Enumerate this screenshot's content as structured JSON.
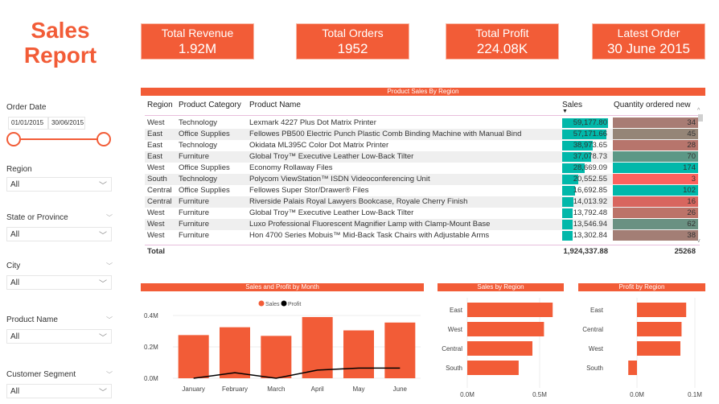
{
  "title": "Sales Report",
  "title_lines": [
    "Sales",
    "Report"
  ],
  "colors": {
    "accent": "#f25c37",
    "teal": "#01b8aa",
    "red": "#fd625e"
  },
  "kpis": [
    {
      "label": "Total Revenue",
      "value": "1.92M"
    },
    {
      "label": "Total Orders",
      "value": "1952"
    },
    {
      "label": "Total Profit",
      "value": "224.08K"
    },
    {
      "label": "Latest Order",
      "value": "30 June 2015"
    }
  ],
  "filters": {
    "order_date": {
      "label": "Order Date",
      "start": "01/01/2015",
      "end": "30/06/2015"
    },
    "region": {
      "label": "Region",
      "value": "All"
    },
    "state": {
      "label": "State or Province",
      "value": "All"
    },
    "city": {
      "label": "City",
      "value": "All"
    },
    "product_name": {
      "label": "Product Name",
      "value": "All"
    },
    "customer_segment": {
      "label": "Customer Segment",
      "value": "All"
    }
  },
  "table": {
    "title": "Product Sales By Region",
    "columns": [
      "Region",
      "Product Category",
      "Product Name",
      "Sales",
      "Quantity ordered new"
    ],
    "sort_indicator": "▼",
    "rows": [
      {
        "region": "West",
        "category": "Technology",
        "product": "Lexmark 4227 Plus Dot Matrix Printer",
        "sales": "59,177.80",
        "sales_num": 59177.8,
        "qty": "34",
        "qty_color": "#a87c74"
      },
      {
        "region": "East",
        "category": "Office Supplies",
        "product": "Fellowes PB500 Electric Punch Plastic Comb Binding Machine with Manual Bind",
        "sales": "57,171.66",
        "sales_num": 57171.66,
        "qty": "45",
        "qty_color": "#958577"
      },
      {
        "region": "East",
        "category": "Technology",
        "product": "Okidata ML395C Color Dot Matrix Printer",
        "sales": "38,973.65",
        "sales_num": 38973.65,
        "qty": "28",
        "qty_color": "#b7756c"
      },
      {
        "region": "East",
        "category": "Furniture",
        "product": "Global Troy™ Executive Leather Low-Back Tilter",
        "sales": "37,078.73",
        "sales_num": 37078.73,
        "qty": "70",
        "qty_color": "#5c9886"
      },
      {
        "region": "West",
        "category": "Office Supplies",
        "product": "Economy Rollaway Files",
        "sales": "28,669.09",
        "sales_num": 28669.09,
        "qty": "174",
        "qty_color": "#01b8aa"
      },
      {
        "region": "South",
        "category": "Technology",
        "product": "Polycom ViewStation™ ISDN Videoconferencing Unit",
        "sales": "20,552.55",
        "sales_num": 20552.55,
        "qty": "3",
        "qty_color": "#fd625e"
      },
      {
        "region": "Central",
        "category": "Office Supplies",
        "product": "Fellowes Super Stor/Drawer® Files",
        "sales": "16,692.85",
        "sales_num": 16692.85,
        "qty": "102",
        "qty_color": "#01b8aa"
      },
      {
        "region": "Central",
        "category": "Furniture",
        "product": "Riverside Palais Royal Lawyers Bookcase, Royale Cherry Finish",
        "sales": "14,013.92",
        "sales_num": 14013.92,
        "qty": "16",
        "qty_color": "#d8665f"
      },
      {
        "region": "West",
        "category": "Furniture",
        "product": "Global Troy™ Executive Leather Low-Back Tilter",
        "sales": "13,792.48",
        "sales_num": 13792.48,
        "qty": "26",
        "qty_color": "#bc7369"
      },
      {
        "region": "West",
        "category": "Furniture",
        "product": "Luxo Professional Fluorescent Magnifier Lamp with Clamp-Mount Base",
        "sales": "13,546.94",
        "sales_num": 13546.94,
        "qty": "62",
        "qty_color": "#6a9182"
      },
      {
        "region": "West",
        "category": "Furniture",
        "product": "Hon 4700 Series Mobuis™ Mid-Back Task Chairs with Adjustable Arms",
        "sales": "13,302.84",
        "sales_num": 13302.84,
        "qty": "38",
        "qty_color": "#a37e75"
      }
    ],
    "total": {
      "label": "Total",
      "sales": "1,924,337.88",
      "qty": "25268"
    }
  },
  "chart_data": [
    {
      "type": "bar",
      "title": "Sales and Profit by Month",
      "categories": [
        "January",
        "February",
        "March",
        "April",
        "May",
        "June"
      ],
      "series": [
        {
          "name": "Sales",
          "type": "bar",
          "color": "#f25c37",
          "values": [
            0.275,
            0.325,
            0.27,
            0.39,
            0.305,
            0.355
          ]
        },
        {
          "name": "Profit",
          "type": "line",
          "color": "#000000",
          "values": [
            0.0,
            0.035,
            0.0,
            0.052,
            0.065,
            0.065
          ]
        }
      ],
      "yticks": [
        "0.0M",
        "0.2M",
        "0.4M"
      ],
      "ylim": [
        0,
        0.4
      ],
      "yunit": "M",
      "legend": "top-center",
      "grid": true
    },
    {
      "type": "bar",
      "orientation": "horizontal",
      "title": "Sales by Region",
      "categories": [
        "East",
        "West",
        "Central",
        "South"
      ],
      "values": [
        0.59,
        0.53,
        0.45,
        0.355
      ],
      "xticks": [
        "0.0M",
        "0.5M"
      ],
      "xlim": [
        0,
        0.5
      ],
      "grid": true
    },
    {
      "type": "bar",
      "orientation": "horizontal",
      "title": "Profit by Region",
      "categories": [
        "East",
        "Central",
        "West",
        "South"
      ],
      "values": [
        0.085,
        0.077,
        0.075,
        -0.015
      ],
      "xticks": [
        "0.0M",
        "0.1M"
      ],
      "xlim": [
        0,
        0.1
      ],
      "grid": true
    }
  ]
}
